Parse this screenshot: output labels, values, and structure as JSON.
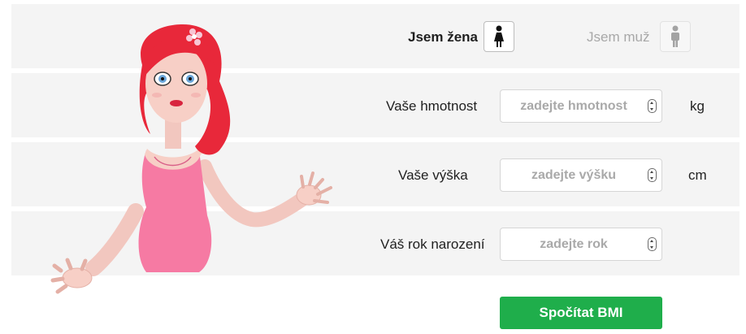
{
  "gender": {
    "female_label": "Jsem žena",
    "male_label": "Jsem muž",
    "selected": "female"
  },
  "fields": {
    "weight": {
      "label": "Vaše hmotnost",
      "placeholder": "zadejte hmotnost",
      "unit": "kg",
      "value": ""
    },
    "height": {
      "label": "Vaše výška",
      "placeholder": "zadejte výšku",
      "unit": "cm",
      "value": ""
    },
    "birth_year": {
      "label": "Váš rok narození",
      "placeholder": "zadejte rok",
      "value": ""
    }
  },
  "submit_label": "Spočítat BMI",
  "colors": {
    "band": "#f4f4f4",
    "button": "#1fae4b",
    "hair": "#e8283a",
    "dress": "#f67aa3",
    "skin": "#f7cfc6"
  },
  "icons": {
    "female": "female-figure-icon",
    "male": "male-figure-icon",
    "spinner": "number-spinner-icon"
  }
}
